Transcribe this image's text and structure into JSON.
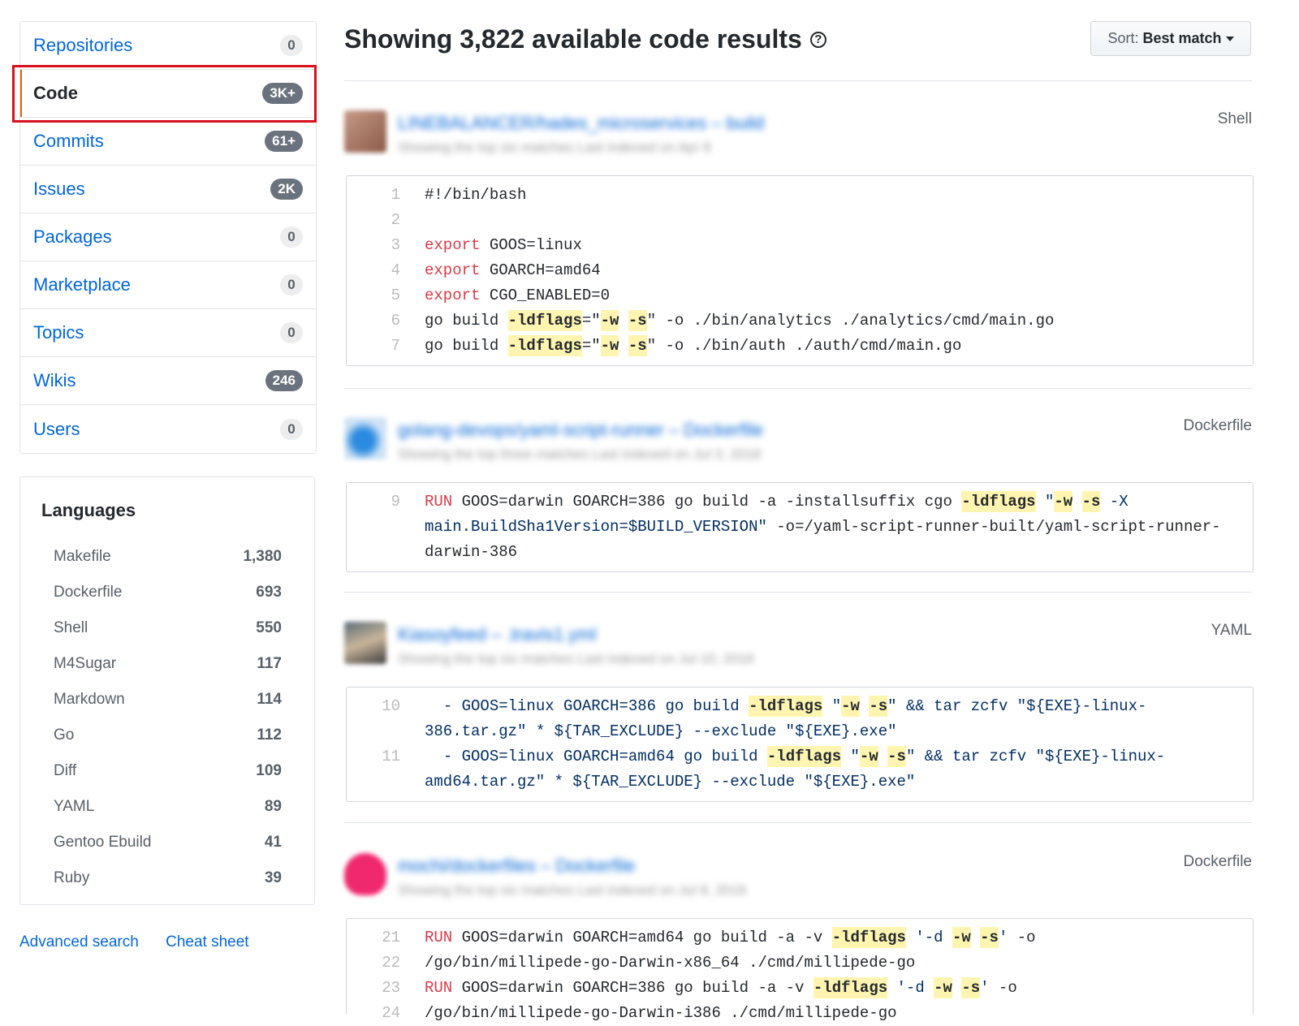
{
  "sidebar": {
    "items": [
      {
        "label": "Repositories",
        "count": "0"
      },
      {
        "label": "Code",
        "count": "3K+"
      },
      {
        "label": "Commits",
        "count": "61+"
      },
      {
        "label": "Issues",
        "count": "2K"
      },
      {
        "label": "Packages",
        "count": "0"
      },
      {
        "label": "Marketplace",
        "count": "0"
      },
      {
        "label": "Topics",
        "count": "0"
      },
      {
        "label": "Wikis",
        "count": "246"
      },
      {
        "label": "Users",
        "count": "0"
      }
    ],
    "languages_title": "Languages",
    "languages": [
      {
        "name": "Makefile",
        "count": "1,380"
      },
      {
        "name": "Dockerfile",
        "count": "693"
      },
      {
        "name": "Shell",
        "count": "550"
      },
      {
        "name": "M4Sugar",
        "count": "117"
      },
      {
        "name": "Markdown",
        "count": "114"
      },
      {
        "name": "Go",
        "count": "112"
      },
      {
        "name": "Diff",
        "count": "109"
      },
      {
        "name": "YAML",
        "count": "89"
      },
      {
        "name": "Gentoo Ebuild",
        "count": "41"
      },
      {
        "name": "Ruby",
        "count": "39"
      }
    ],
    "advanced_search": "Advanced search",
    "cheat_sheet": "Cheat sheet"
  },
  "main": {
    "heading": "Showing 3,822 available code results",
    "sort_label": "Sort:",
    "sort_value": "Best match",
    "results": [
      {
        "language": "Shell",
        "repo": "LINEBALANCER/hades_microservices",
        "file": "build",
        "meta": "Showing the top six matches   Last indexed on Apr 8"
      },
      {
        "language": "Dockerfile",
        "repo": "golang-devops/yaml-script-runner",
        "file": "Dockerfile",
        "meta": "Showing the top three matches   Last indexed on Jul 3, 2018"
      },
      {
        "language": "YAML",
        "repo": "Kiasoyfeed",
        "file": ".travis1.yml",
        "meta": "Showing the top six matches   Last indexed on Jul 10, 2018"
      },
      {
        "language": "Dockerfile",
        "repo": "mochi/dockerfiles",
        "file": "Dockerfile",
        "meta": "Showing the top six matches   Last indexed on Jul 8, 2018"
      }
    ]
  },
  "colors": {
    "link": "#0366d6",
    "selected_bar": "#e36209",
    "annotation": "#d9111c",
    "match_highlight": "#fff5b1"
  }
}
